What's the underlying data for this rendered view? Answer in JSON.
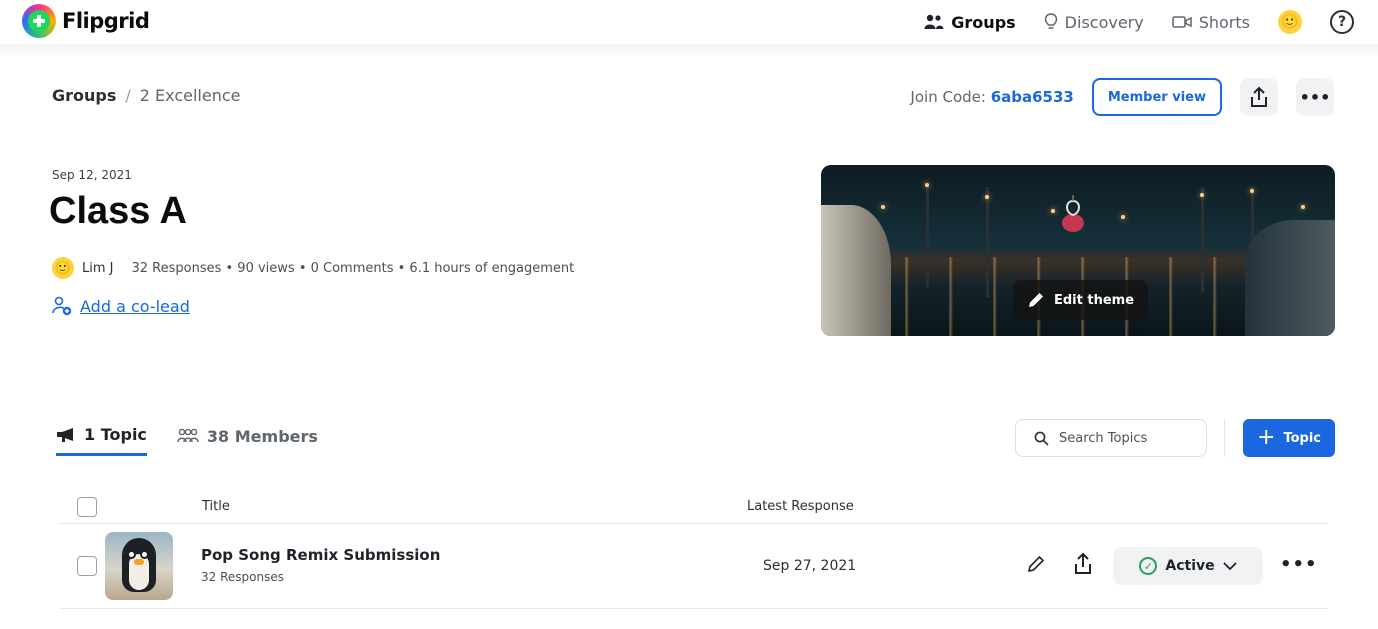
{
  "brand": {
    "name": "Flipgrid"
  },
  "nav": {
    "items": [
      {
        "label": "Groups",
        "icon": "groups-icon",
        "active": true
      },
      {
        "label": "Discovery",
        "icon": "lightbulb-icon",
        "active": false
      },
      {
        "label": "Shorts",
        "icon": "video-camera-icon",
        "active": false
      }
    ],
    "avatar_emoji": "🙂",
    "help_glyph": "?"
  },
  "breadcrumb": {
    "root": "Groups",
    "separator": "/",
    "current": "2 Excellence"
  },
  "actions": {
    "join_label": "Join Code: ",
    "join_code": "6aba6533",
    "member_view_label": "Member view",
    "share_glyph": "⇧",
    "more_glyph": "•••"
  },
  "group": {
    "date": "Sep 12, 2021",
    "title": "Class A",
    "owner": "Lim J",
    "stats": "32 Responses • 90 views • 0 Comments • 6.1 hours of engagement",
    "add_colead_label": "Add a co-lead"
  },
  "theme": {
    "edit_label": "Edit theme"
  },
  "tabs": [
    {
      "label": "1 Topic",
      "icon": "megaphone-icon",
      "active": true
    },
    {
      "label": "38 Members",
      "icon": "members-icon",
      "active": false
    }
  ],
  "search": {
    "placeholder": "Search Topics"
  },
  "add_topic": {
    "label": "Topic",
    "glyph": "+"
  },
  "table": {
    "headers": {
      "title": "Title",
      "latest": "Latest Response"
    },
    "rows": [
      {
        "title": "Pop Song Remix Submission",
        "subtitle": "32 Responses",
        "latest": "Sep 27, 2021",
        "status": "Active"
      }
    ]
  },
  "colors": {
    "accent": "#1b67e0",
    "success": "#25a05a"
  }
}
